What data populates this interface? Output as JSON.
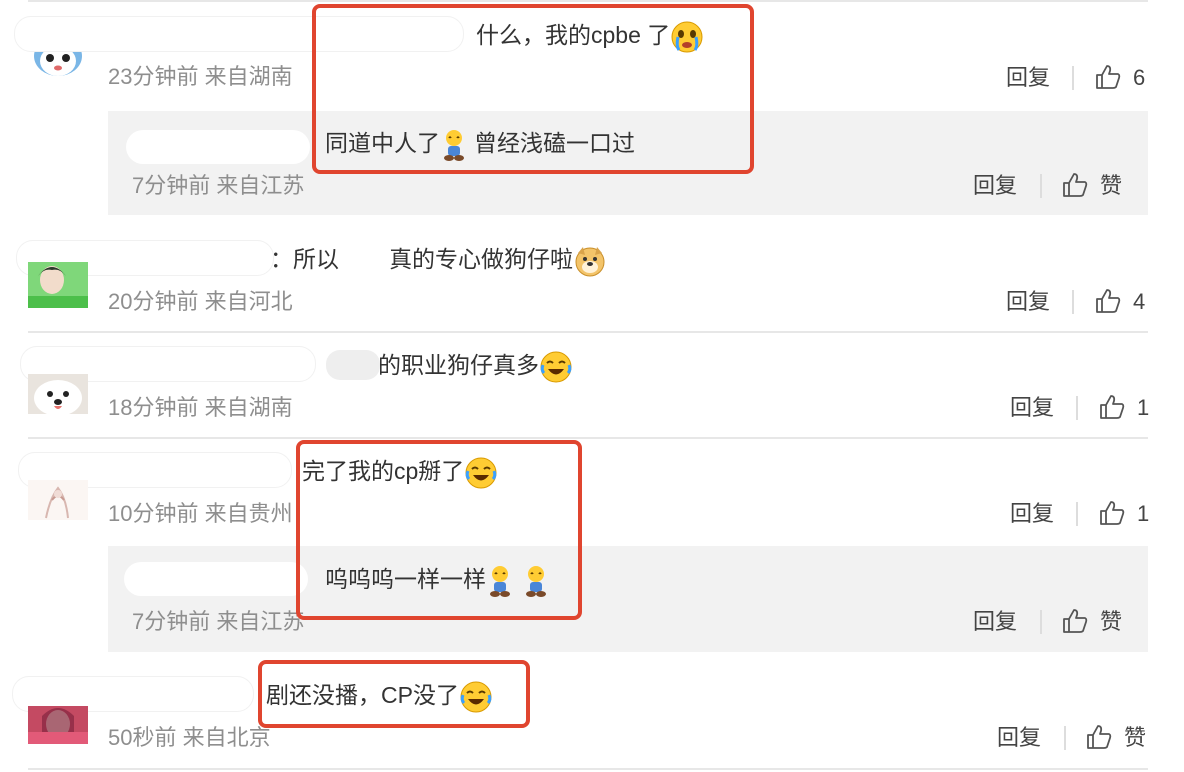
{
  "comments": [
    {
      "text": "什么，我的cpbe 了",
      "time": "23分钟前",
      "location": "来自湖南",
      "reply_label": "回复",
      "likes": "6",
      "reply": {
        "text": "同道中人了",
        "text2": "曾经浅磕一口过",
        "time": "7分钟前",
        "location": "来自江苏",
        "reply_label": "回复",
        "likes": "赞"
      }
    },
    {
      "text_prefix": "：所以",
      "text_suffix": "真的专心做狗仔啦",
      "time": "20分钟前",
      "location": "来自河北",
      "reply_label": "回复",
      "likes": "4"
    },
    {
      "text": "的职业狗仔真多",
      "time": "18分钟前",
      "location": "来自湖南",
      "reply_label": "回复",
      "likes": "1"
    },
    {
      "text": "完了我的cp掰了",
      "time": "10分钟前",
      "location": "来自贵州",
      "reply_label": "回复",
      "likes": "1",
      "reply": {
        "text": "呜呜呜一样一样",
        "time": "7分钟前",
        "location": "来自江苏",
        "reply_label": "回复",
        "likes": "赞"
      }
    },
    {
      "text": "剧还没播，CP没了",
      "time": "50秒前",
      "location": "来自北京",
      "reply_label": "回复",
      "likes": "赞"
    }
  ],
  "colors": {
    "highlight": "#e0452f",
    "reply_bg": "#f2f2f2",
    "meta": "#8e8e8e"
  }
}
